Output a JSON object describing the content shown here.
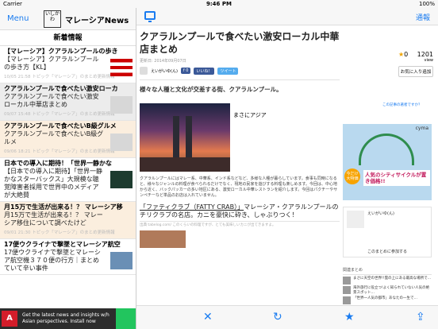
{
  "status": {
    "carrier": "Carrier",
    "time": "9:46 PM",
    "battery": "100%"
  },
  "left": {
    "menu_label": "Menu",
    "logo_text": "いしかわ",
    "app_title": "マレーシアNews",
    "section_title": "新着情報",
    "items": [
      {
        "head": "【マレーシア】クアラルンプールの歩き",
        "body": "【マレーシア】クアラルンプールの歩き方【KL】",
        "meta": "10/05 21:58 トピック「マレーシア」のまとめ更新情報"
      },
      {
        "head": "クアラルンプールで食べたい激安ローカ",
        "body": "クアラルンプールで食べたい激安ローカル中華店まとめ",
        "meta": "09/07 15:48 トピック「マレーシア」のまとめ更新情報"
      },
      {
        "head": "クアラルンプールで食べたいB級グルメ",
        "body": "クアラルンプールで食べたいB級グルメ",
        "meta": "09/06 18:21 トピック「マレーシア」のまとめ更新情報"
      },
      {
        "head": "日本での導入に期待！「世界一静かな",
        "body": "【日本での導入に期待】「世界一静かなスターバックス」大規模な聴覚障害者採用で世界中のメディアが大絶賛",
        "meta": ""
      },
      {
        "head": "月15万で生活が出来る！？ マレーシア移",
        "body": "月15万で生活が出来る！？ マレーシア移住について調べたけど",
        "meta": "09/01 21:30 トピック「マレーシア」のまとめ更新情報"
      },
      {
        "head": "17便ウクライナで撃墜とマレーシア航空",
        "body": "17便ウクライナで撃墜とマレーシア航空機３７０便の行方｜まとめていて辛い事件",
        "meta": ""
      }
    ],
    "ad": {
      "logo": "A",
      "text": "Get the latest news and insights w/h Asian perspectives. Install now"
    }
  },
  "right": {
    "report_label": "通報",
    "article": {
      "title": "クアラルンプールで食べたい激安ローカル中華店まとめ",
      "date": "更新日: 2014年09月07日",
      "author": "えいがいゆ(ん)",
      "share_fb": "f 0",
      "share_like": "いいね！",
      "share_tw": "ツイート",
      "lead": "様々な人種と文化が交差する街、クアラルンプール。",
      "caption": "まさにアジア",
      "para": "クアラルンプールにはマレー系、中華系、インド系などなど、多様な人種が暮らしています。食事も同時になると、様々なジャンルの料理が食べられるだけでなく、現地の民家を遊びする料理も楽しめます。今回は、中心地から近く、バックパッカーの多い地区にある、激安ローカル中華レストランを紹介します。今回はパクチーやサンペチーなど単品のお店は入れていません。",
      "subhead_prefix": "「ファティクラブ（FATTY CRAB）」",
      "subhead_rest": "マレーシア・クアラルンプールのチリクラブの名店。カニを豪快に砕き、しゃぶりつく！",
      "small_meta": "出典 tabelog.com/  このくらいの料理ですが、とても美味しいカニが出てきますよ。"
    },
    "likes": {
      "count": "0",
      "views": "1201",
      "unit": "view",
      "fav_label": "お気に入り追加"
    },
    "side_link": "この記事の著者ですか？",
    "side_ad": {
      "badge": "今だけ 大特価",
      "text": "人気のシティサイクルが置き価格!!",
      "brand": "cyma"
    },
    "author_box": {
      "name": "えいがいゆ(ん)",
      "join": "このまとめに参加する"
    },
    "related": {
      "title": "関連まとめ",
      "items": [
        "まさに天空の世界!!雲の上にある最高な場所で…",
        "海外旅行に役立つ!よく知られていない人気の絶景スポット…",
        "「世界一人気の都市」あなたの一生で…"
      ]
    },
    "toolbar": {
      "close": "✕",
      "refresh": "↻",
      "star": "★",
      "share": "⇪"
    }
  }
}
